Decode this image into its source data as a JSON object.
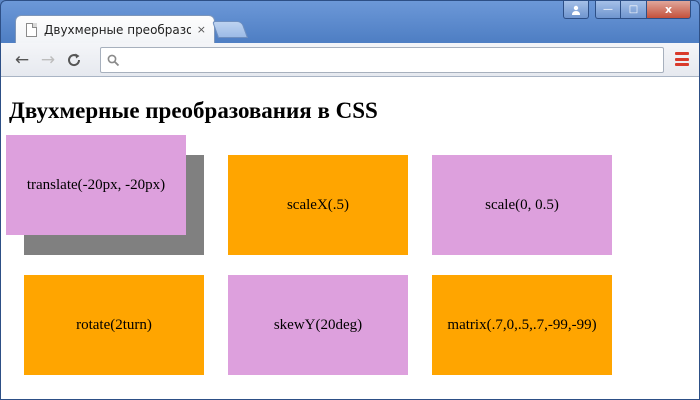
{
  "window": {
    "tab_title": "Двухмерные преобразован",
    "tab_close": "×",
    "controls": {
      "min": "—",
      "max": "□",
      "close": "x"
    }
  },
  "toolbar": {
    "back": "←",
    "forward": "→",
    "reload": "C",
    "search_icon": "search-icon",
    "address_value": ""
  },
  "page": {
    "heading": "Двухмерные преобразования в CSS",
    "boxes": [
      {
        "label": "translate(-20px, -20px)",
        "color": "#dda0dd"
      },
      {
        "label": "scaleX(.5)",
        "color": "#ffa500"
      },
      {
        "label": "scale(0, 0.5)",
        "color": "#dda0dd"
      },
      {
        "label": "rotate(2turn)",
        "color": "#ffa500"
      },
      {
        "label": "skewY(20deg)",
        "color": "#dda0dd"
      },
      {
        "label": "matrix(.7,0,.5,.7,-99,-99)",
        "color": "#ffa500"
      }
    ],
    "ghost_color": "#808080"
  }
}
